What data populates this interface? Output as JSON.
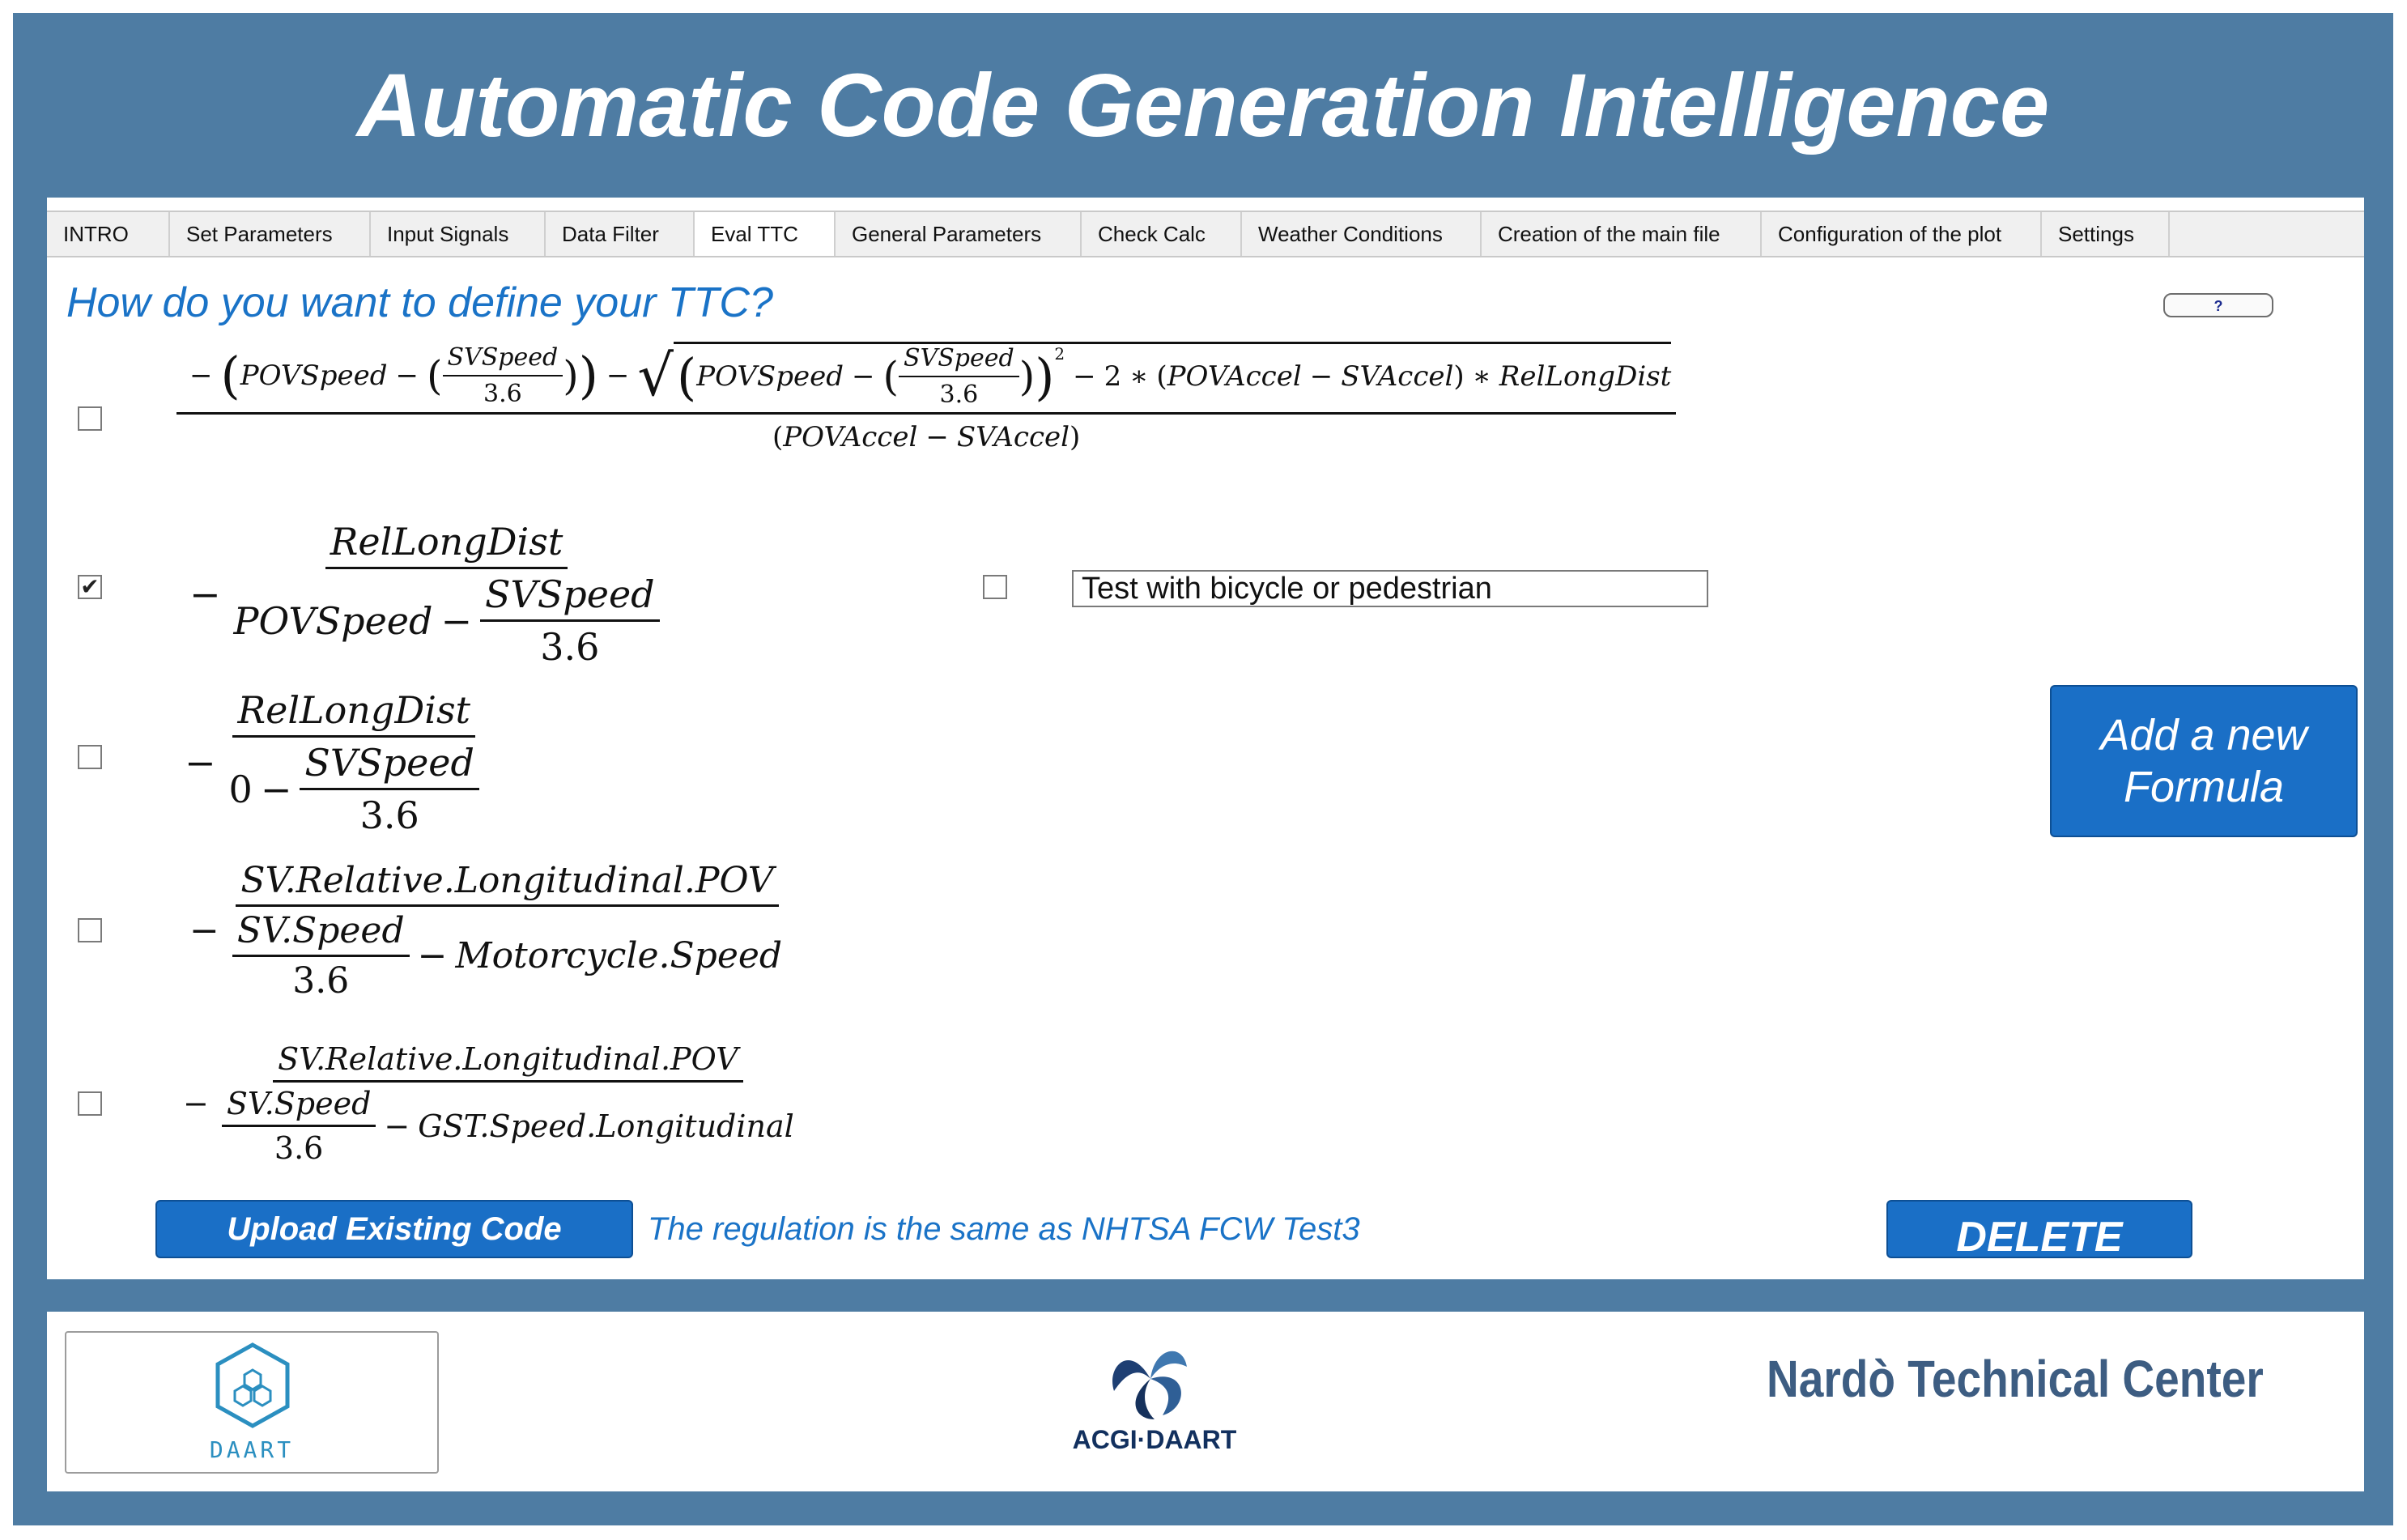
{
  "app": {
    "title": "Automatic Code Generation Intelligence"
  },
  "tabs": [
    {
      "label": "INTRO",
      "active": false
    },
    {
      "label": "Set Parameters",
      "active": false
    },
    {
      "label": "Input Signals",
      "active": false
    },
    {
      "label": "Data Filter",
      "active": false
    },
    {
      "label": "Eval TTC",
      "active": true
    },
    {
      "label": "General Parameters",
      "active": false
    },
    {
      "label": "Check Calc",
      "active": false
    },
    {
      "label": "Weather Conditions",
      "active": false
    },
    {
      "label": "Creation of the main file",
      "active": false
    },
    {
      "label": "Configuration of the plot",
      "active": false
    },
    {
      "label": "Settings",
      "active": false
    }
  ],
  "eval_ttc": {
    "question": "How do you want to define your TTC?",
    "help_label": "?",
    "formulas": [
      {
        "checked": false,
        "t_pov_speed": "POVSpeed",
        "t_sv_speed": "SVSpeed",
        "t_div": "3.6",
        "t_exp": "2",
        "t_coef": "2",
        "t_pov_accel": "POVAccel",
        "t_sv_accel": "SVAccel",
        "t_rel_dist": "RelLongDist"
      },
      {
        "checked": true,
        "numerator": "RelLongDist",
        "minuend": "POVSpeed",
        "sub_numerator": "SVSpeed",
        "sub_denominator": "3.6"
      },
      {
        "checked": false,
        "numerator": "RelLongDist",
        "minuend": "0",
        "sub_numerator": "SVSpeed",
        "sub_denominator": "3.6"
      },
      {
        "checked": false,
        "numerator": "SV.Relative.Longitudinal.POV",
        "sub_numerator": "SV.Speed",
        "sub_denominator": "3.6",
        "subtrahend": "Motorcycle.Speed"
      },
      {
        "checked": false,
        "numerator": "SV.Relative.Longitudinal.POV",
        "sub_numerator": "SV.Speed",
        "sub_denominator": "3.6",
        "subtrahend": "GST.Speed.Longitudinal"
      }
    ],
    "bicycle_pedestrian": {
      "checked": false,
      "value": "Test with bicycle or pedestrian"
    },
    "add_formula_label": "Add a new Formula",
    "upload_label": "Upload Existing Code",
    "regulation_note": "The regulation is the same as NHTSA FCW Test3",
    "delete_label": "DELETE"
  },
  "footer": {
    "left_logo_text": "DAART",
    "center_logo_text": "ACGI·DAART",
    "right_logo_text": "Nardò Technical Center"
  },
  "colors": {
    "frame": "#4e7ca3",
    "accent_blue": "#1a6fc6",
    "link_text": "#1a73c7",
    "nardo_text": "#3d5d82",
    "acgi_text": "#12305e",
    "daart_text": "#2b8fc0"
  }
}
